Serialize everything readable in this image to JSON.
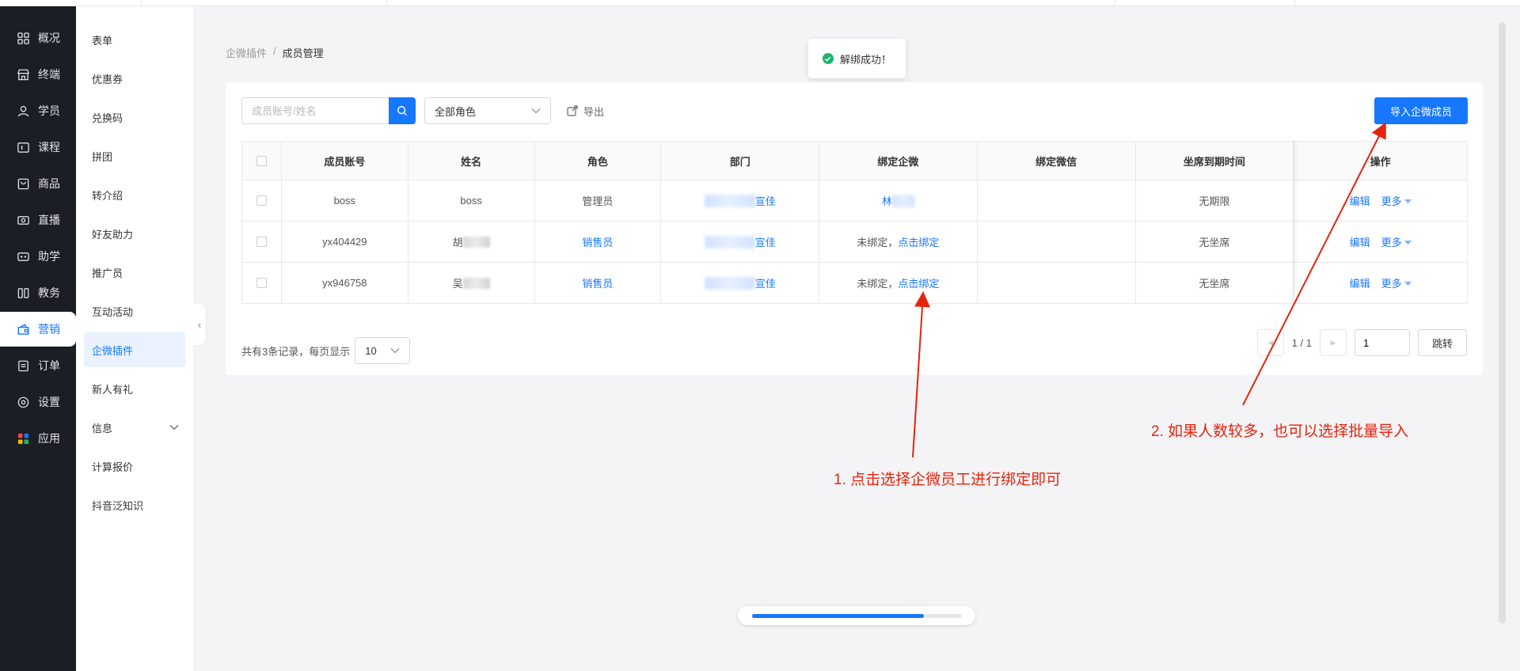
{
  "primary_nav": [
    {
      "label": "概况",
      "icon": "dashboard-icon"
    },
    {
      "label": "终端",
      "icon": "store-icon"
    },
    {
      "label": "学员",
      "icon": "student-icon"
    },
    {
      "label": "课程",
      "icon": "course-icon"
    },
    {
      "label": "商品",
      "icon": "goods-icon"
    },
    {
      "label": "直播",
      "icon": "live-icon"
    },
    {
      "label": "助学",
      "icon": "assist-icon"
    },
    {
      "label": "教务",
      "icon": "teaching-icon"
    },
    {
      "label": "营销",
      "icon": "marketing-icon",
      "active": true
    },
    {
      "label": "订单",
      "icon": "order-icon"
    },
    {
      "label": "设置",
      "icon": "settings-icon"
    },
    {
      "label": "应用",
      "icon": "apps-icon"
    }
  ],
  "secondary_nav": [
    {
      "label": "表单"
    },
    {
      "label": "优惠券"
    },
    {
      "label": "兑换码"
    },
    {
      "label": "拼团"
    },
    {
      "label": "转介绍"
    },
    {
      "label": "好友助力"
    },
    {
      "label": "推广员"
    },
    {
      "label": "互动活动"
    },
    {
      "label": "企微插件",
      "active": true
    },
    {
      "label": "新人有礼"
    },
    {
      "label": "信息",
      "expandable": true
    },
    {
      "label": "计算报价"
    },
    {
      "label": "抖音泛知识"
    }
  ],
  "breadcrumb": {
    "parent": "企微插件",
    "separator": "/",
    "current": "成员管理"
  },
  "toast": {
    "message": "解绑成功！"
  },
  "toolbar": {
    "search_placeholder": "成员账号/姓名",
    "role_filter": "全部角色",
    "export_label": "导出",
    "import_label": "导入企微成员"
  },
  "table": {
    "headers": [
      "成员账号",
      "姓名",
      "角色",
      "部门",
      "绑定企微",
      "绑定微信",
      "坐席到期时间",
      "操作"
    ],
    "rows": [
      {
        "account": "boss",
        "name": "boss",
        "role": "管理员",
        "role_link": false,
        "department_tail": "宣佳",
        "wecom": "林",
        "wecom_bound": true,
        "wechat": "",
        "seat_expiry": "无期限",
        "edit": "编辑",
        "more": "更多"
      },
      {
        "account": "yx404429",
        "name": "胡",
        "role": "销售员",
        "role_link": true,
        "department_tail": "宣佳",
        "wecom_unbound": "未绑定，",
        "wecom_bind": "点击绑定",
        "wecom_bound": false,
        "wechat": "",
        "seat_expiry": "无坐席",
        "edit": "编辑",
        "more": "更多"
      },
      {
        "account": "yx946758",
        "name": "吴",
        "role": "销售员",
        "role_link": true,
        "department_tail": "宣佳",
        "wecom_unbound": "未绑定，",
        "wecom_bind": "点击绑定",
        "wecom_bound": false,
        "wechat": "",
        "seat_expiry": "无坐席",
        "edit": "编辑",
        "more": "更多"
      }
    ]
  },
  "pagination": {
    "total_text": "共有3条记录，每页显示",
    "page_size": "10",
    "page_indicator": "1 / 1",
    "jump_value": "1",
    "jump_label": "跳转"
  },
  "annotations": {
    "note1": "1. 点击选择企微员工进行绑定即可",
    "note2": "2. 如果人数较多，也可以选择批量导入"
  },
  "progress": {
    "fraction": 0.82
  },
  "colors": {
    "accent": "#1677ff",
    "nav_bg": "#1b1e24",
    "annotation": "#e8230c",
    "success": "#1fb46f"
  }
}
